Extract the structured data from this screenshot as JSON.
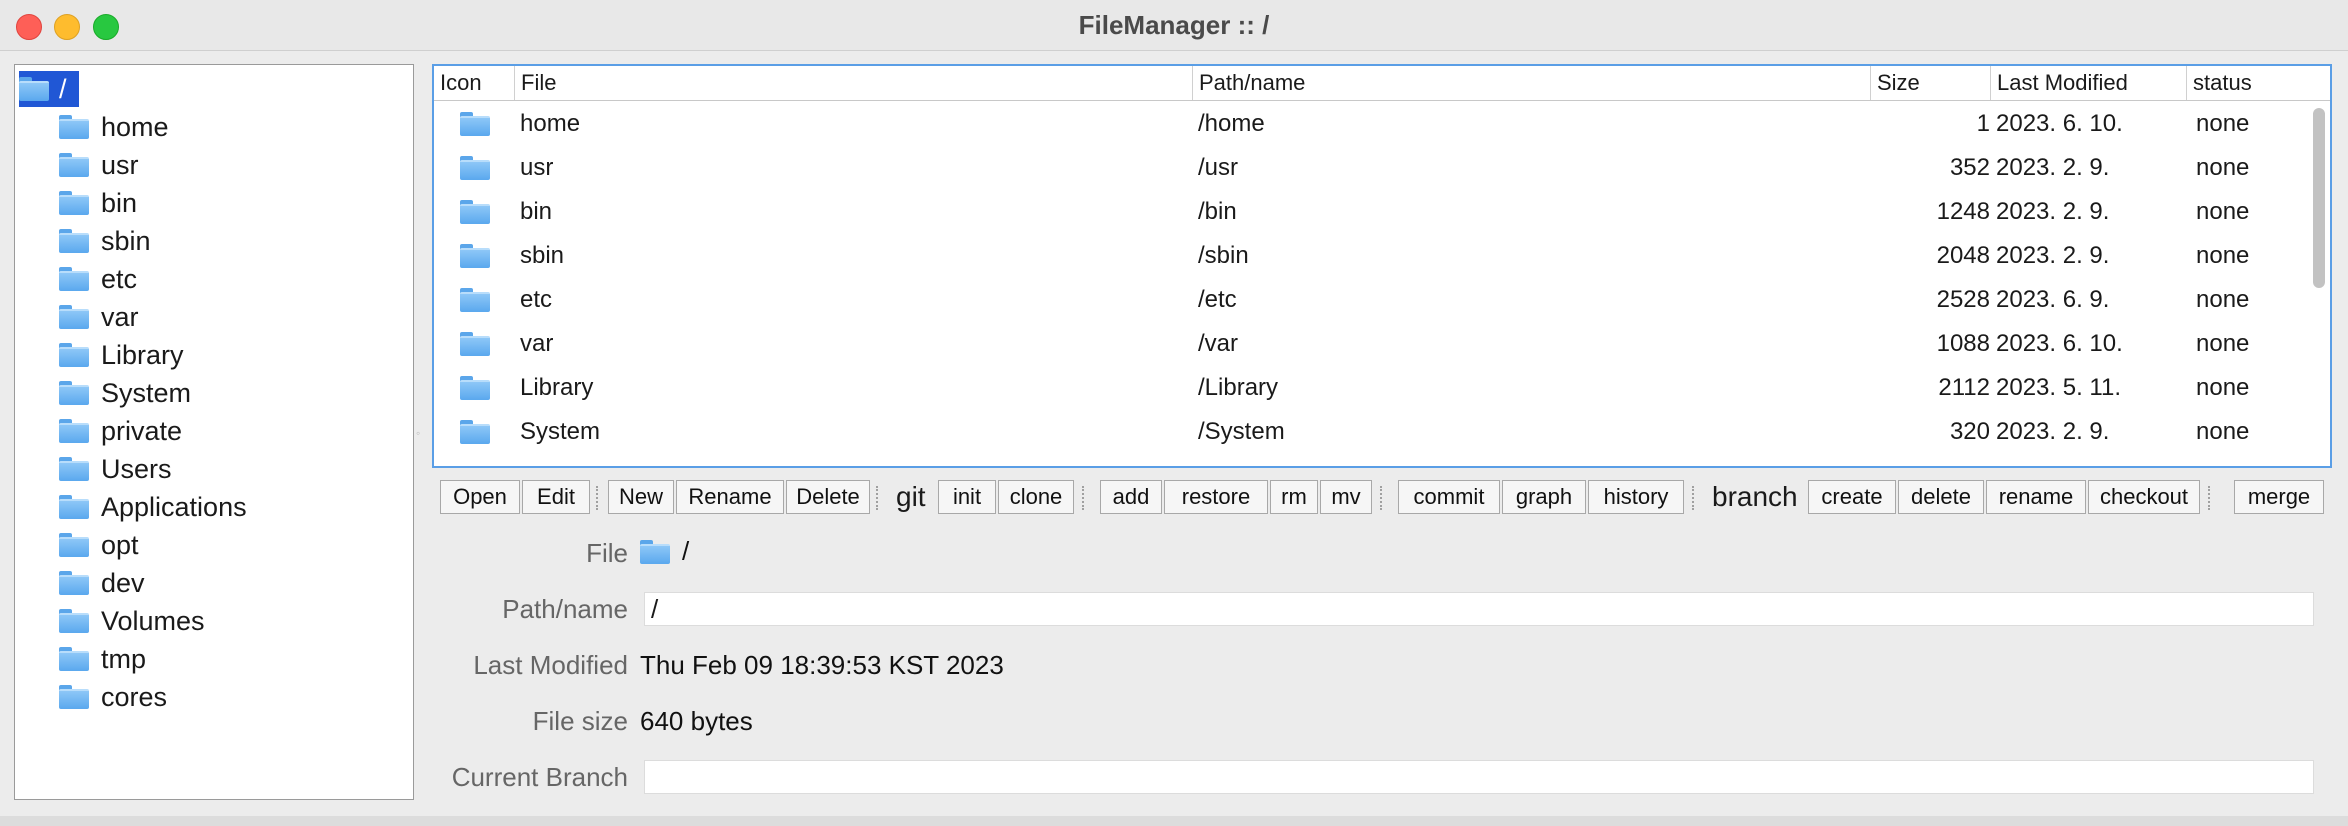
{
  "window": {
    "title": "FileManager :: /"
  },
  "tree": {
    "root": "/",
    "items": [
      "home",
      "usr",
      "bin",
      "sbin",
      "etc",
      "var",
      "Library",
      "System",
      "private",
      "Users",
      "Applications",
      "opt",
      "dev",
      "Volumes",
      "tmp",
      "cores"
    ]
  },
  "table": {
    "columns": [
      "Icon",
      "File",
      "Path/name",
      "Size",
      "Last Modified",
      "status"
    ],
    "rows": [
      {
        "file": "home",
        "path": "/home",
        "size": "1",
        "modified": "2023. 6. 10.",
        "status": "none"
      },
      {
        "file": "usr",
        "path": "/usr",
        "size": "352",
        "modified": "2023. 2. 9.",
        "status": "none"
      },
      {
        "file": "bin",
        "path": "/bin",
        "size": "1248",
        "modified": "2023. 2. 9.",
        "status": "none"
      },
      {
        "file": "sbin",
        "path": "/sbin",
        "size": "2048",
        "modified": "2023. 2. 9.",
        "status": "none"
      },
      {
        "file": "etc",
        "path": "/etc",
        "size": "2528",
        "modified": "2023. 6. 9.",
        "status": "none"
      },
      {
        "file": "var",
        "path": "/var",
        "size": "1088",
        "modified": "2023. 6. 10.",
        "status": "none"
      },
      {
        "file": "Library",
        "path": "/Library",
        "size": "2112",
        "modified": "2023. 5. 11.",
        "status": "none"
      },
      {
        "file": "System",
        "path": "/System",
        "size": "320",
        "modified": "2023. 2. 9.",
        "status": "none"
      }
    ]
  },
  "toolbar": {
    "open": "Open",
    "edit": "Edit",
    "new": "New",
    "rename": "Rename",
    "delete": "Delete",
    "git_label": "git",
    "init": "init",
    "clone": "clone",
    "add": "add",
    "restore": "restore",
    "rm": "rm",
    "mv": "mv",
    "commit": "commit",
    "graph": "graph",
    "history": "history",
    "branch_label": "branch",
    "create": "create",
    "branch_delete": "delete",
    "branch_rename": "rename",
    "checkout": "checkout",
    "merge": "merge"
  },
  "details": {
    "file_label": "File",
    "file_value": "/",
    "path_label": "Path/name",
    "path_value": "/",
    "modified_label": "Last Modified",
    "modified_value": "Thu Feb 09 18:39:53 KST 2023",
    "size_label": "File size",
    "size_value": "640 bytes",
    "branch_label": "Current Branch",
    "branch_value": ""
  }
}
